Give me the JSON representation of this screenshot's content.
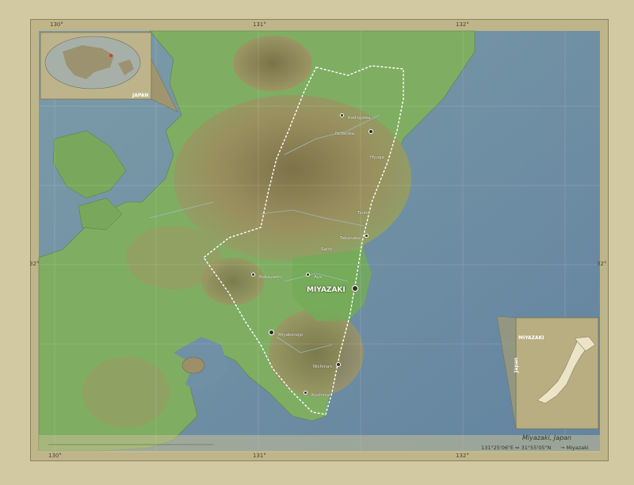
{
  "map": {
    "title": "Miyazaki, Japan",
    "coordinates": "131°25'06\"E  ⇔  31°55'05\"N",
    "arrow_label": "Miyazaki",
    "region_label": "MIYAZAKI",
    "country_label": "Japan",
    "world_inset_label": "JAPAN",
    "top_ticks": [
      "130°",
      "131°",
      "132°"
    ],
    "bottom_ticks": [
      "130°",
      "131°",
      "132°"
    ],
    "left_ticks": [
      "32°"
    ],
    "right_ticks": [
      "32°"
    ],
    "colors": {
      "sea": "#6f8fa3",
      "lowland": "#6ea45c",
      "hills": "#a89d64",
      "mountains": "#8e7f56",
      "boundary": "#ffffff",
      "frame": "#bfb58a"
    }
  },
  "cities": [
    {
      "name": "Miyazaki",
      "capital": true
    },
    {
      "name": "Nobeoka",
      "capital": false
    },
    {
      "name": "Hyuga",
      "capital": false
    },
    {
      "name": "Kadogawa",
      "capital": false
    },
    {
      "name": "Tsuno",
      "capital": false
    },
    {
      "name": "Takanabe",
      "capital": false
    },
    {
      "name": "Saito",
      "capital": false
    },
    {
      "name": "Kobayashi",
      "capital": false
    },
    {
      "name": "Aya",
      "capital": false
    },
    {
      "name": "Miyakonojo",
      "capital": false
    },
    {
      "name": "Nichinan",
      "capital": false
    },
    {
      "name": "Kushima",
      "capital": false
    }
  ],
  "icons": {
    "city_marker": "dot-icon",
    "capital_marker": "capital-dot-icon",
    "location_arrow": "arrow-icon"
  }
}
